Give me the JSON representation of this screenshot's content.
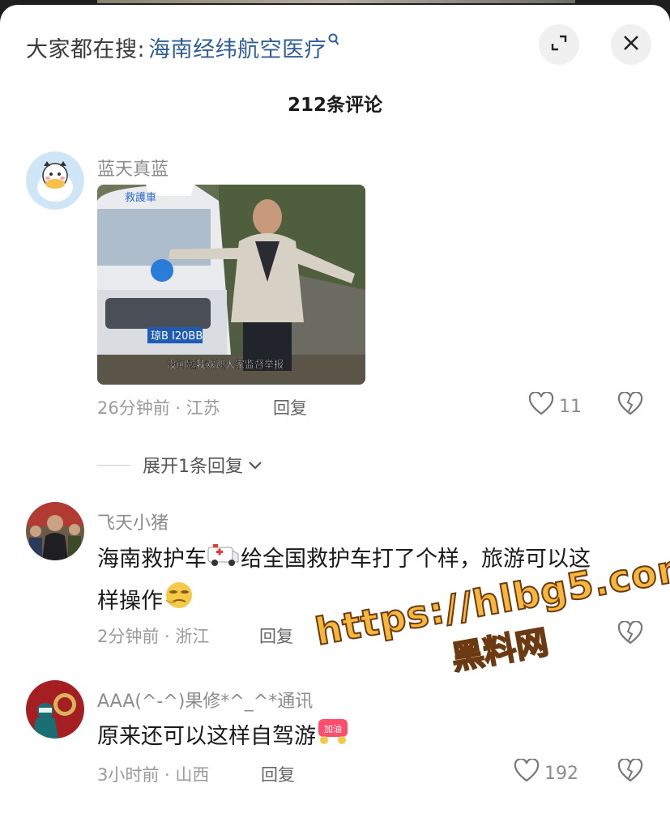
{
  "search": {
    "prefix": "大家都在搜:",
    "query": "海南经纬航空医疗"
  },
  "header": {
    "comment_count": "212条评论"
  },
  "comments": [
    {
      "username": "蓝天真蓝",
      "photo_caption": "没问题我欢迎大家监督举报",
      "photo_plate": "琼B I20BB",
      "photo_van_label": "救護車",
      "time_location": "26分钟前 · 江苏",
      "reply_label": "回复",
      "likes": "11",
      "expand_replies_label": "展开1条回复"
    },
    {
      "username": "飞天小猪",
      "text_part1": "海南救护车",
      "text_part2": "给全国救护车打了个样，旅游可以这",
      "text_line2": "样操作",
      "time_location": "2分钟前 · 浙江",
      "reply_label": "回复"
    },
    {
      "username": "AAA(^-^)果修*^_^*通讯",
      "text": "原来还可以这样自驾游",
      "sticker_label": "加油",
      "time_location": "3小时前 · 山西",
      "reply_label": "回复",
      "likes": "192"
    }
  ],
  "watermark": {
    "url": "https://hlbg5.com",
    "label": "黑料网"
  },
  "colors": {
    "accent_link": "#2f5d98",
    "muted_text": "#8c8c8c",
    "watermark_fill": "#f6b73c"
  },
  "icons": [
    "expand-icon",
    "close-icon",
    "heart-icon",
    "broken-heart-icon",
    "chevron-down-icon",
    "search-icon"
  ]
}
